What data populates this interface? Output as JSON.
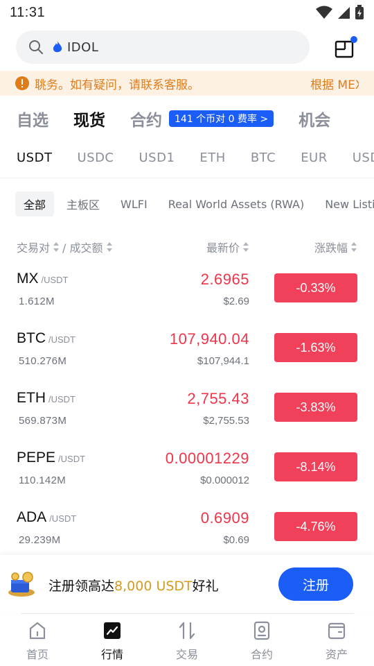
{
  "status_bar": {
    "time": "11:31"
  },
  "search": {
    "query": "IDOL"
  },
  "notice": {
    "text": "聎务。如有疑问，请联系客服。",
    "right_text": "根据 MEX"
  },
  "main_tabs": [
    {
      "label": "自选",
      "active": false
    },
    {
      "label": "现货",
      "active": true
    },
    {
      "label": "合约",
      "active": false
    },
    {
      "label": "机会",
      "active": false
    }
  ],
  "contract_badge": "141 个币对 0 费率 >",
  "quote_tabs": [
    {
      "label": "USDT",
      "active": true
    },
    {
      "label": "USDC",
      "active": false
    },
    {
      "label": "USD1",
      "active": false
    },
    {
      "label": "ETH",
      "active": false
    },
    {
      "label": "BTC",
      "active": false
    },
    {
      "label": "EUR",
      "active": false
    },
    {
      "label": "USDE",
      "active": false
    }
  ],
  "chips": [
    {
      "label": "全部",
      "active": true
    },
    {
      "label": "主板区",
      "active": false
    },
    {
      "label": "WLFI",
      "active": false
    },
    {
      "label": "Real World Assets (RWA)",
      "active": false
    },
    {
      "label": "New Listing",
      "active": false
    }
  ],
  "columns": {
    "pair": "交易对",
    "volume": "/ 成交额",
    "price": "最新价",
    "change": "涨跌幅"
  },
  "rows": [
    {
      "symbol": "MX",
      "quote": "/USDT",
      "volume": "1.612M",
      "price": "2.6965",
      "usd": "$2.69",
      "change": "-0.33%"
    },
    {
      "symbol": "BTC",
      "quote": "/USDT",
      "volume": "510.276M",
      "price": "107,940.04",
      "usd": "$107,944.1",
      "change": "-1.63%"
    },
    {
      "symbol": "ETH",
      "quote": "/USDT",
      "volume": "569.873M",
      "price": "2,755.43",
      "usd": "$2,755.53",
      "change": "-3.83%"
    },
    {
      "symbol": "PEPE",
      "quote": "/USDT",
      "volume": "110.142M",
      "price": "0.00001229",
      "usd": "$0.000012",
      "change": "-8.14%"
    },
    {
      "symbol": "ADA",
      "quote": "/USDT",
      "volume": "29.239M",
      "price": "0.6909",
      "usd": "$0.69",
      "change": "-4.76%"
    }
  ],
  "register": {
    "text_before": "注册领高达",
    "highlight": "8,000 USDT",
    "text_after": "好礼",
    "button": "注册"
  },
  "bottom_nav": [
    {
      "label": "首页",
      "icon": "home-icon",
      "active": false
    },
    {
      "label": "行情",
      "icon": "market-chart-icon",
      "active": true
    },
    {
      "label": "交易",
      "icon": "trade-arrows-icon",
      "active": false
    },
    {
      "label": "合约",
      "icon": "futures-icon",
      "active": false
    },
    {
      "label": "资产",
      "icon": "wallet-icon",
      "active": false
    }
  ],
  "colors": {
    "accent": "#1a5ef7",
    "down": "#f0405a",
    "highlight": "#d69a1f",
    "notice": "#e07b1a"
  }
}
